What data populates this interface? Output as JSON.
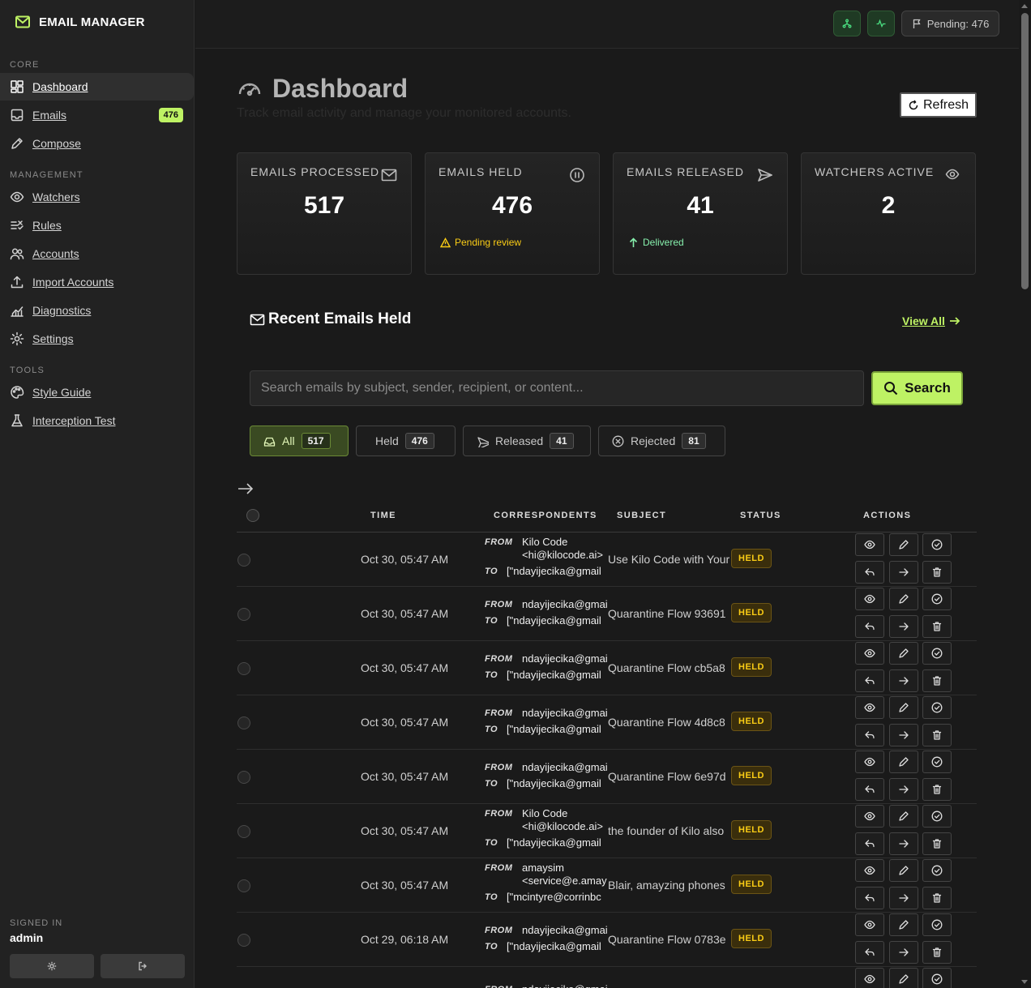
{
  "app": {
    "title": "EMAIL MANAGER"
  },
  "sidebar": {
    "sections": [
      {
        "label": "CORE",
        "items": [
          {
            "label": "Dashboard",
            "icon": "dashboard-icon",
            "active": true
          },
          {
            "label": "Emails",
            "icon": "inbox-icon",
            "badge": "476"
          },
          {
            "label": "Compose",
            "icon": "pencil-icon"
          }
        ]
      },
      {
        "label": "MANAGEMENT",
        "items": [
          {
            "label": "Watchers",
            "icon": "eye-icon"
          },
          {
            "label": "Rules",
            "icon": "filter-rules-icon"
          },
          {
            "label": "Accounts",
            "icon": "users-icon"
          },
          {
            "label": "Import Accounts",
            "icon": "upload-icon"
          },
          {
            "label": "Diagnostics",
            "icon": "chart-icon"
          },
          {
            "label": "Settings",
            "icon": "gear-icon"
          }
        ]
      },
      {
        "label": "TOOLS",
        "items": [
          {
            "label": "Style Guide",
            "icon": "palette-icon"
          },
          {
            "label": "Interception Test",
            "icon": "flask-icon"
          }
        ]
      }
    ],
    "signed_in_label": "SIGNED IN",
    "user": "admin"
  },
  "topbar": {
    "pending_label": "Pending: 476"
  },
  "page": {
    "title": "Dashboard",
    "subtitle": "Track email activity and manage your monitored accounts.",
    "refresh_label": "Refresh"
  },
  "stats": [
    {
      "label": "EMAILS PROCESSED",
      "value": "517",
      "icon": "mail-icon",
      "note": ""
    },
    {
      "label": "EMAILS HELD",
      "value": "476",
      "icon": "pause-icon",
      "note": "Pending review",
      "note_type": "warn"
    },
    {
      "label": "EMAILS RELEASED",
      "value": "41",
      "icon": "send-icon",
      "note": "Delivered",
      "note_type": "ok"
    },
    {
      "label": "WATCHERS ACTIVE",
      "value": "2",
      "icon": "eye-icon",
      "note": ""
    }
  ],
  "recent": {
    "title": "Recent Emails Held",
    "view_all": "View All",
    "search_placeholder": "Search emails by subject, sender, recipient, or content...",
    "search_label": "Search",
    "filters": [
      {
        "label": "All",
        "count": "517",
        "icon": "inbox-tray-icon",
        "active": true
      },
      {
        "label": "Held",
        "count": "476",
        "icon": ""
      },
      {
        "label": "Released",
        "count": "41",
        "icon": "send-icon"
      },
      {
        "label": "Rejected",
        "count": "81",
        "icon": "x-circle-icon"
      }
    ],
    "columns": {
      "time": "TIME",
      "correspondents": "CORRESPONDENTS",
      "subject": "SUBJECT",
      "status": "STATUS",
      "actions": "ACTIONS"
    },
    "from_label": "FROM",
    "to_label": "TO",
    "rows": [
      {
        "time": "Oct 30, 05:47 AM",
        "from": [
          "Kilo Code",
          "<hi@kilocode.ai>"
        ],
        "to": "[\"ndayijecika@gmail",
        "subject": "Use Kilo Code with Your",
        "status": "HELD"
      },
      {
        "time": "Oct 30, 05:47 AM",
        "from": [
          "ndayijecika@gmail"
        ],
        "to": "[\"ndayijecika@gmail",
        "subject": "Quarantine Flow 93691",
        "status": "HELD"
      },
      {
        "time": "Oct 30, 05:47 AM",
        "from": [
          "ndayijecika@gmail"
        ],
        "to": "[\"ndayijecika@gmail",
        "subject": "Quarantine Flow cb5a8",
        "status": "HELD"
      },
      {
        "time": "Oct 30, 05:47 AM",
        "from": [
          "ndayijecika@gmail"
        ],
        "to": "[\"ndayijecika@gmail",
        "subject": "Quarantine Flow 4d8c8",
        "status": "HELD"
      },
      {
        "time": "Oct 30, 05:47 AM",
        "from": [
          "ndayijecika@gmail"
        ],
        "to": "[\"ndayijecika@gmail",
        "subject": "Quarantine Flow 6e97d",
        "status": "HELD"
      },
      {
        "time": "Oct 30, 05:47 AM",
        "from": [
          "Kilo Code",
          "<hi@kilocode.ai>"
        ],
        "to": "[\"ndayijecika@gmail",
        "subject": "the founder of Kilo also",
        "status": "HELD"
      },
      {
        "time": "Oct 30, 05:47 AM",
        "from": [
          "amaysim",
          "<service@e.amaysim"
        ],
        "to": "[\"mcintyre@corrinbc",
        "subject": "Blair, amayzing phones",
        "status": "HELD"
      },
      {
        "time": "Oct 29, 06:18 AM",
        "from": [
          "ndayijecika@gmail"
        ],
        "to": "[\"ndayijecika@gmail",
        "subject": "Quarantine Flow 0783e",
        "status": "HELD"
      },
      {
        "time": "",
        "from": [
          "ndayijecika@gmail"
        ],
        "to": "",
        "subject": "",
        "status": ""
      }
    ]
  }
}
